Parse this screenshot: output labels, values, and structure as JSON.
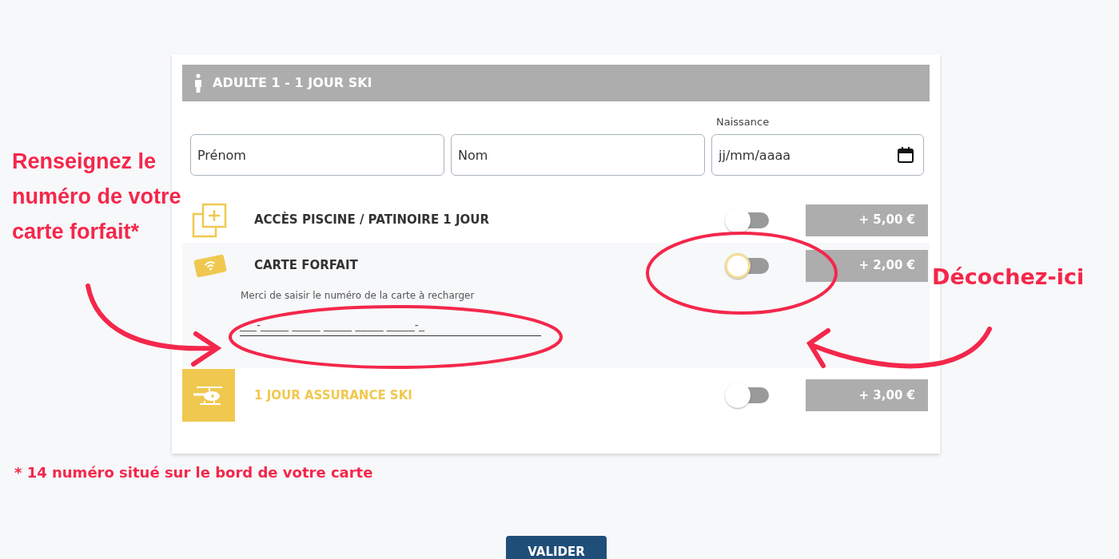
{
  "passenger": {
    "title": "ADULTE 1 - 1 JOUR SKI",
    "fields": [
      {
        "placeholder": "Prénom"
      },
      {
        "placeholder": "Nom"
      },
      {
        "label": "Naissance",
        "placeholder": "jj/mm/aaaa"
      }
    ]
  },
  "options": [
    {
      "label": "ACCÈS PISCINE / PATINOIRE 1 JOUR",
      "on": false,
      "focused": false,
      "highlighted": false,
      "price": "+ 5,00 €"
    },
    {
      "label": "CARTE FORFAIT",
      "on": false,
      "focused": true,
      "highlighted": false,
      "price": "+ 2,00 €",
      "hint": "Merci de saisir le numéro de la carte à recharger",
      "mask": "___-_____ _____ _____ _____ _____-_"
    },
    {
      "label": "1 JOUR ASSURANCE SKI",
      "on": false,
      "focused": false,
      "highlighted": true,
      "price": "+ 3,00 €"
    }
  ],
  "submit": "VALIDER",
  "annotations": {
    "left": "Renseignez le numéro de votre carte forfait*",
    "right": "Décochez-ici",
    "footnote": "* 14 numéro situé sur le bord de votre carte"
  }
}
